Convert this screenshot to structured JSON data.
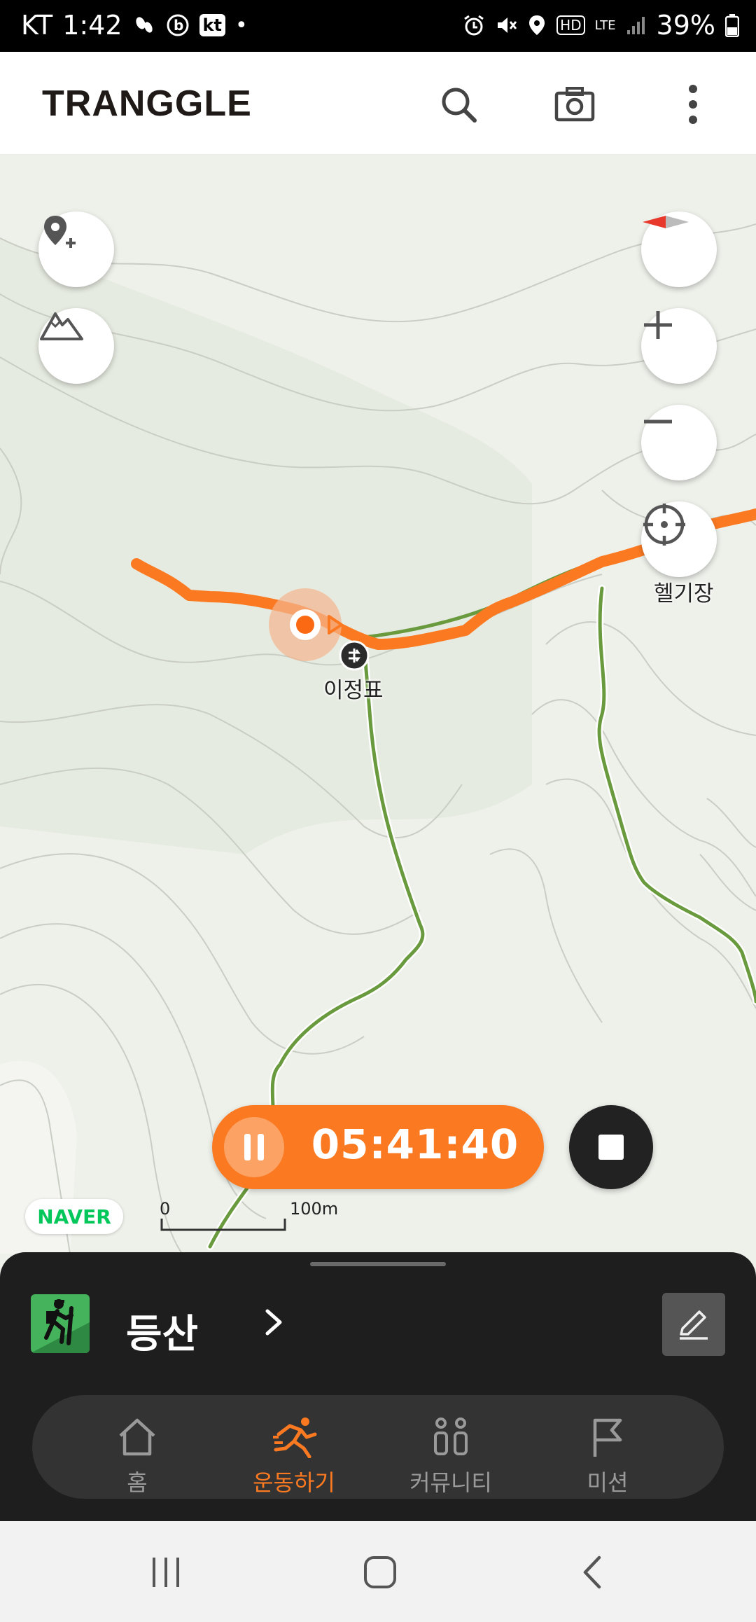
{
  "status_bar": {
    "carrier": "KT",
    "time": "1:42",
    "kt_badge": "kt",
    "dot": "•",
    "icons": [
      "footprint-icon",
      "b-app-icon",
      "kt-icon",
      "alarm-icon",
      "mute-icon",
      "location-icon",
      "hd-icon",
      "lte-icon",
      "signal-icon",
      "battery-icon"
    ],
    "hd": "HD",
    "lte": "LTE",
    "battery": "39%"
  },
  "header": {
    "logo": "TRANGGLE",
    "actions": [
      "search-icon",
      "camera-icon",
      "more-vert-icon"
    ]
  },
  "map": {
    "left_buttons": [
      "add-location-icon",
      "mountain-icon"
    ],
    "right_buttons": [
      "compass-icon",
      "zoom-in-icon",
      "zoom-out-icon",
      "my-location-icon"
    ],
    "labels": {
      "signpost": "이정표",
      "helipad": "헬기장"
    },
    "track_color": "#fb7a21",
    "trail_color": "#6a9a3e",
    "attribution": "NAVER",
    "scale": {
      "start": "0",
      "end": "100m"
    }
  },
  "recorder": {
    "elapsed": "05:41:40",
    "accent": "#fb7a21"
  },
  "activity": {
    "label": "등산",
    "icon": "hiking-icon"
  },
  "bottom_nav": {
    "items": [
      {
        "label": "홈",
        "icon": "home-icon",
        "active": false
      },
      {
        "label": "운동하기",
        "icon": "running-icon",
        "active": true
      },
      {
        "label": "커뮤니티",
        "icon": "community-icon",
        "active": false
      },
      {
        "label": "미션",
        "icon": "flag-icon",
        "active": false
      }
    ]
  },
  "system_nav": [
    "recents-icon",
    "home-button-icon",
    "back-icon"
  ]
}
